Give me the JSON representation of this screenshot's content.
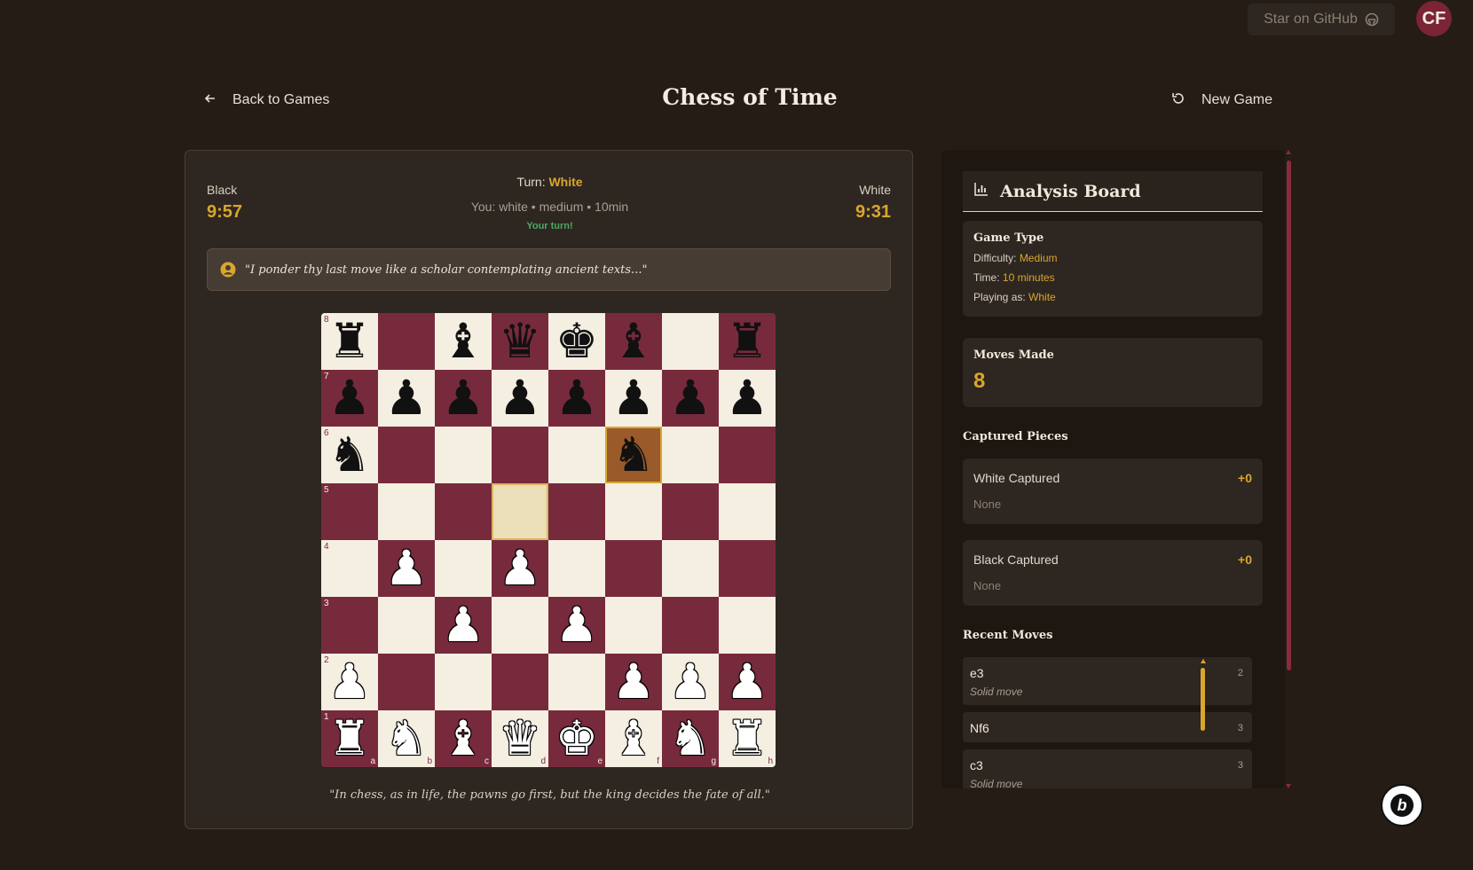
{
  "topbar": {
    "github_label": "Star on GitHub",
    "avatar_initials": "CF"
  },
  "header": {
    "back_label": "Back to Games",
    "title": "Chess of Time",
    "new_game_label": "New Game"
  },
  "game": {
    "black_label": "Black",
    "black_clock": "9:57",
    "white_label": "White",
    "white_clock": "9:31",
    "turn_prefix": "Turn:",
    "turn_value": "White",
    "you_line": "You: white • medium • 10min",
    "your_turn": "Your turn!",
    "opponent_message": "\"I ponder thy last move like a scholar contemplating ancient texts...\"",
    "quote": "\"In chess, as in life, the pawns go first, but the king decides the fate of all.\""
  },
  "board": {
    "ranks": [
      "8",
      "7",
      "6",
      "5",
      "4",
      "3",
      "2",
      "1"
    ],
    "files": [
      "a",
      "b",
      "c",
      "d",
      "e",
      "f",
      "g",
      "h"
    ],
    "position": [
      [
        "bR",
        "",
        "bB",
        "bQ",
        "bK",
        "bB",
        "",
        "bR"
      ],
      [
        "bP",
        "bP",
        "bP",
        "bP",
        "bP",
        "bP",
        "bP",
        "bP"
      ],
      [
        "bN",
        "",
        "",
        "",
        "",
        "bN",
        "",
        ""
      ],
      [
        "",
        "",
        "",
        "",
        "",
        "",
        "",
        ""
      ],
      [
        "",
        "wP",
        "",
        "wP",
        "",
        "",
        "",
        ""
      ],
      [
        "",
        "",
        "wP",
        "",
        "wP",
        "",
        "",
        ""
      ],
      [
        "wP",
        "",
        "",
        "",
        "",
        "wP",
        "wP",
        "wP"
      ],
      [
        "wR",
        "wN",
        "wB",
        "wQ",
        "wK",
        "wB",
        "wN",
        "wR"
      ]
    ],
    "highlight_from": "d5",
    "highlight_selected": "f6"
  },
  "analysis": {
    "title": "Analysis Board",
    "game_type": {
      "title": "Game Type",
      "difficulty_label": "Difficulty:",
      "difficulty_value": "Medium",
      "time_label": "Time:",
      "time_value": "10 minutes",
      "playing_label": "Playing as:",
      "playing_value": "White"
    },
    "moves_made": {
      "title": "Moves Made",
      "count": "8"
    },
    "captured": {
      "title": "Captured Pieces",
      "white_label": "White Captured",
      "white_score": "+0",
      "white_pieces": "None",
      "black_label": "Black Captured",
      "black_score": "+0",
      "black_pieces": "None"
    },
    "recent_moves": {
      "title": "Recent Moves",
      "items": [
        {
          "san": "e3",
          "num": "2",
          "comment": "Solid move"
        },
        {
          "san": "Nf6",
          "num": "3",
          "comment": ""
        },
        {
          "san": "c3",
          "num": "3",
          "comment": "Solid move"
        }
      ]
    }
  },
  "colors": {
    "accent": "#d9a62e",
    "board_dark": "#782a3d",
    "board_light": "#f5efe2",
    "background": "#241c15"
  }
}
